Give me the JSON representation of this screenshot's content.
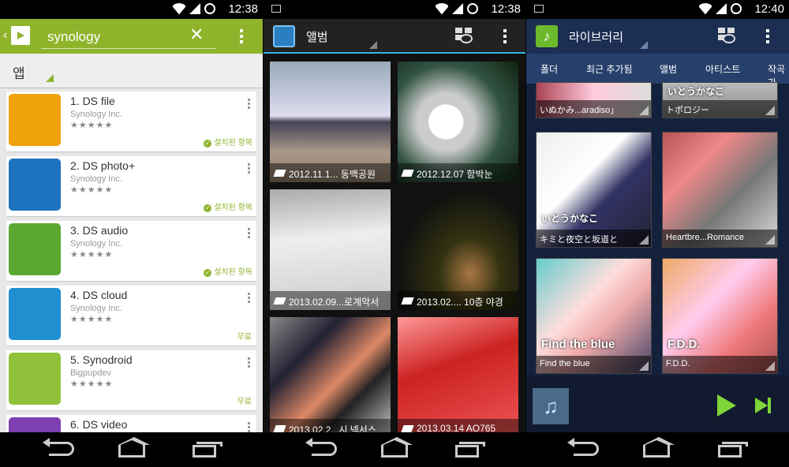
{
  "status_bars": [
    {
      "time": "12:38"
    },
    {
      "time": "12:38"
    },
    {
      "time": "12:40"
    }
  ],
  "playstore": {
    "search_query": "synology",
    "category_label": "앱",
    "apps": [
      {
        "name": "1. DS file",
        "developer": "Synology Inc.",
        "rating": "★★★★★",
        "status": "설치된 항목",
        "installed": true,
        "icon": "folder-sync-icon",
        "icon_color": "#f0a30a"
      },
      {
        "name": "2. DS photo+",
        "developer": "Synology Inc.",
        "rating": "★★★★★",
        "status": "설치된 항목",
        "installed": true,
        "icon": "photo-icon",
        "icon_color": "#1e73be"
      },
      {
        "name": "3. DS audio",
        "developer": "Synology Inc.",
        "rating": "★★★★★",
        "status": "설치된 항목",
        "installed": true,
        "icon": "music-note-icon",
        "icon_color": "#5aa832"
      },
      {
        "name": "4. DS cloud",
        "developer": "Synology Inc.",
        "rating": "★★★★★",
        "status": "무료",
        "installed": false,
        "icon": "cloud-sync-icon",
        "icon_color": "#1f8fcf"
      },
      {
        "name": "5. Synodroid",
        "developer": "Bigpupdev",
        "rating": "★★★★★",
        "status": "무료",
        "installed": false,
        "icon": "android-icon",
        "icon_color": "#8fc23a"
      },
      {
        "name": "6. DS video",
        "developer": "Synology Inc.",
        "rating": "★★★★★",
        "status": "",
        "installed": false,
        "icon": "clapper-icon",
        "icon_color": "#7e3fb0"
      }
    ]
  },
  "gallery": {
    "title": "앨범",
    "albums": [
      {
        "caption": "2012.11.1... 동백공원"
      },
      {
        "caption": "2012.12.07 함박눈"
      },
      {
        "caption": "2013.02.09...로계악서"
      },
      {
        "caption": "2013.02.... 10층 야경"
      },
      {
        "caption": "2013.02.2...시 넥서스"
      },
      {
        "caption": "2013.03.14 AO765"
      }
    ]
  },
  "music": {
    "title": "라이브러리",
    "tabs": [
      "폴더",
      "최근 추가됨",
      "앨범",
      "아티스트",
      "작곡가"
    ],
    "active_tab": "최근 추가됨",
    "albums": [
      {
        "title": "いぬかみ...aradiso」",
        "cover_text": ""
      },
      {
        "title": "トポロジー",
        "cover_text": "いとうかなこ"
      },
      {
        "title": "キミと夜空と坂道と",
        "cover_text": "いとうかなこ"
      },
      {
        "title": "Heartbre...Romance",
        "cover_text": ""
      },
      {
        "title": "Find the blue",
        "cover_text": "Find the blue"
      },
      {
        "title": "F.D.D.",
        "cover_text": "F.D.D."
      }
    ]
  }
}
